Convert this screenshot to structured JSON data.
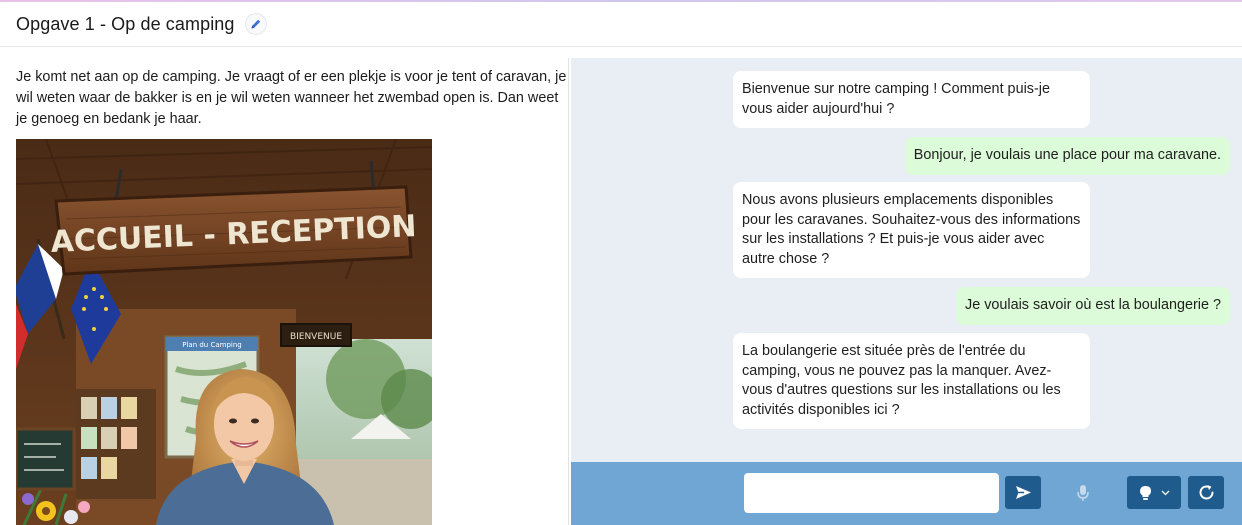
{
  "header": {
    "title": "Opgave 1 - Op de camping"
  },
  "task": {
    "description": "Je komt net aan op de camping. Je vraagt of er een plekje is voor je tent of caravan, je wil weten waar de bakker is en je wil weten wanneer het zwembad open is. Dan weet je genoeg en bedank je haar.",
    "image": {
      "sign_text": "ACCUEIL - RECEPTION",
      "small_sign_text": "BIENVENUE",
      "map_text": "Plan du Camping"
    }
  },
  "chat": {
    "messages": [
      {
        "role": "bot",
        "text": "Bienvenue sur notre camping ! Comment puis-je vous aider aujourd'hui ?"
      },
      {
        "role": "user",
        "text": "Bonjour, je voulais une place pour ma caravane."
      },
      {
        "role": "bot",
        "text": "Nous avons plusieurs emplacements disponibles pour les caravanes. Souhaitez-vous des informations sur les installations ? Et puis-je vous aider avec autre chose ?"
      },
      {
        "role": "user",
        "text": "Je voulais savoir où est la boulangerie ?"
      },
      {
        "role": "bot",
        "text": "La boulangerie est située près de l'entrée du camping, vous ne pouvez pas la manquer. Avez-vous d'autres questions sur les installations ou les activités disponibles ici ?"
      }
    ],
    "input": {
      "value": "",
      "placeholder": ""
    }
  },
  "icons": {
    "edit": "pencil-icon",
    "send": "send-arrow-icon",
    "mic": "microphone-icon",
    "hint": "lightbulb-icon",
    "dropdown": "chevron-down-icon",
    "restart": "refresh-icon"
  },
  "colors": {
    "chat_background": "#e8eef4",
    "bot_bubble": "#ffffff",
    "user_bubble": "#dcfbd8",
    "input_bar": "#6fa6d4",
    "button": "#1f5b8c",
    "edit_icon": "#3b6fd8"
  }
}
